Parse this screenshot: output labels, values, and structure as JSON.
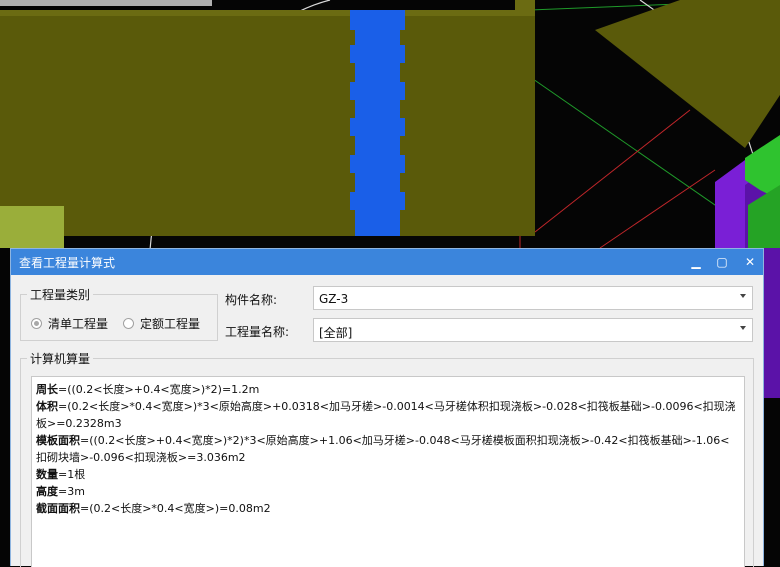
{
  "dialog": {
    "title": "查看工程量计算式",
    "minimize_glyph": "▁",
    "maximize_glyph": "▢",
    "close_glyph": "✕"
  },
  "quantity_type": {
    "legend": "工程量类别",
    "options": [
      {
        "label": "清单工程量",
        "checked": true
      },
      {
        "label": "定额工程量",
        "checked": false
      }
    ]
  },
  "component": {
    "name_label": "构件名称:",
    "name_value": "GZ-3",
    "quantity_name_label": "工程量名称:",
    "quantity_name_value": "[全部]"
  },
  "computer_calc": {
    "legend": "计算机算量",
    "lines": [
      {
        "key": "周长",
        "expr": "=((0.2<长度>+0.4<宽度>)*2)=1.2m"
      },
      {
        "key": "体积",
        "expr": "=(0.2<长度>*0.4<宽度>)*3<原始高度>+0.0318<加马牙槎>-0.0014<马牙槎体积扣现浇板>-0.028<扣筏板基础>-0.0096<扣现浇板>=0.2328m3"
      },
      {
        "key": "模板面积",
        "expr": "=((0.2<长度>+0.4<宽度>)*2)*3<原始高度>+1.06<加马牙槎>-0.048<马牙槎模板面积扣现浇板>-0.42<扣筏板基础>-1.06<扣砌块墙>-0.096<扣现浇板>=3.036m2"
      },
      {
        "key": "数量",
        "expr": "=1根"
      },
      {
        "key": "高度",
        "expr": "=3m"
      },
      {
        "key": "截面面积",
        "expr": "=(0.2<长度>*0.4<宽度>)=0.08m2"
      }
    ]
  },
  "colors": {
    "titlebar": "#3b85dc",
    "olive_member": "#5a5a0a",
    "blue_member": "#1a5fe8",
    "purple_member": "#7a1fd6",
    "green_member": "#2fc32f"
  }
}
